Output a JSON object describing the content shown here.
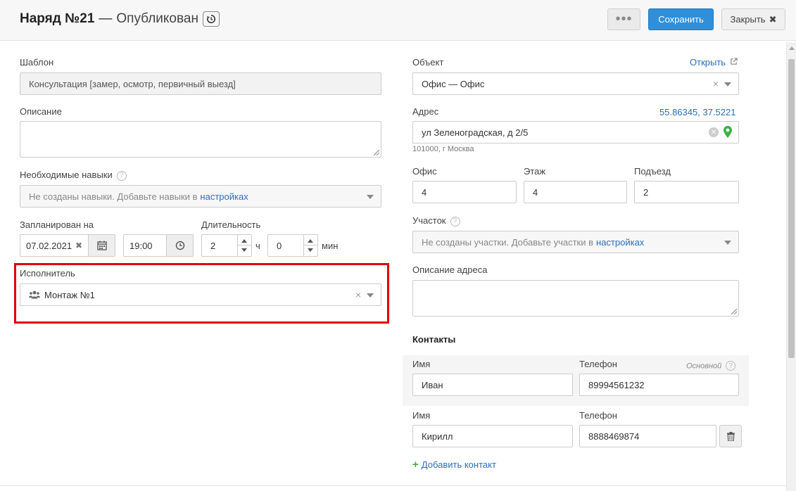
{
  "header": {
    "title_num": "Наряд №21",
    "title_sep": "—",
    "status": "Опубликован",
    "more_label": "•••",
    "save_label": "Сохранить",
    "close_label": "Закрыть"
  },
  "left": {
    "template_label": "Шаблон",
    "template_value": "Консультация [замер, осмотр, первичный выезд]",
    "description_label": "Описание",
    "skills_label": "Необходимые навыки",
    "skills_placeholder": "Не созданы навыки. Добавьте навыки в",
    "skills_link": "настройках",
    "planned_label": "Запланирован на",
    "date_value": "07.02.2021",
    "time_value": "19:00",
    "duration_label": "Длительность",
    "hours_value": "2",
    "hours_unit": "ч",
    "minutes_value": "0",
    "minutes_unit": "мин",
    "executor_label": "Исполнитель",
    "executor_value": "Монтаж №1"
  },
  "right": {
    "object_label": "Объект",
    "object_open_link": "Открыть",
    "object_value": "Офис — Офис",
    "address_label": "Адрес",
    "coords": "55.86345, 37.5221",
    "address_value": "ул Зеленоградская, д 2/5",
    "address_sub": "101000, г Москва",
    "office_label": "Офис",
    "office_value": "4",
    "floor_label": "Этаж",
    "floor_value": "4",
    "entrance_label": "Подъезд",
    "entrance_value": "2",
    "district_label": "Участок",
    "district_placeholder": "Не созданы участки. Добавьте участки в",
    "district_link": "настройках",
    "address_desc_label": "Описание адреса",
    "contacts_title": "Контакты",
    "contacts": [
      {
        "name_label": "Имя",
        "phone_label": "Телефон",
        "name": "Иван",
        "phone": "89994561232",
        "primary_label": "Основной"
      },
      {
        "name_label": "Имя",
        "phone_label": "Телефон",
        "name": "Кирилл",
        "phone": "8888469874"
      }
    ],
    "add_contact": "Добавить контакт"
  },
  "colors": {
    "accent": "#2f8fd8",
    "link": "#2a6ebb",
    "highlight": "#e00000",
    "map_pin": "#3cb043"
  }
}
